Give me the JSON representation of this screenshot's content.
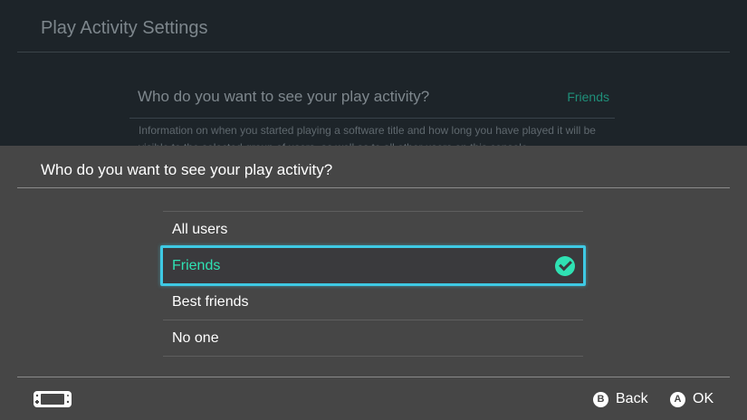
{
  "background": {
    "title": "Play Activity Settings",
    "setting_label": "Who do you want to see your play activity?",
    "setting_value": "Friends",
    "description": "Information on when you started playing a software title and how long you have played it will be visible to the selected group of users, as well as to all other users on this console."
  },
  "dialog": {
    "title": "Who do you want to see your play activity?",
    "options": [
      {
        "label": "All users"
      },
      {
        "label": "Friends",
        "selected": true
      },
      {
        "label": "Best friends"
      },
      {
        "label": "No one"
      }
    ]
  },
  "footer": {
    "console_icon": "handheld-console-icon",
    "back": {
      "glyph": "B",
      "label": "Back"
    },
    "ok": {
      "glyph": "A",
      "label": "OK"
    }
  },
  "colors": {
    "accent": "#2fe1b3",
    "focus": "#3ec9e4",
    "dialog_bg": "#464646",
    "page_bg": "#1d2429"
  }
}
